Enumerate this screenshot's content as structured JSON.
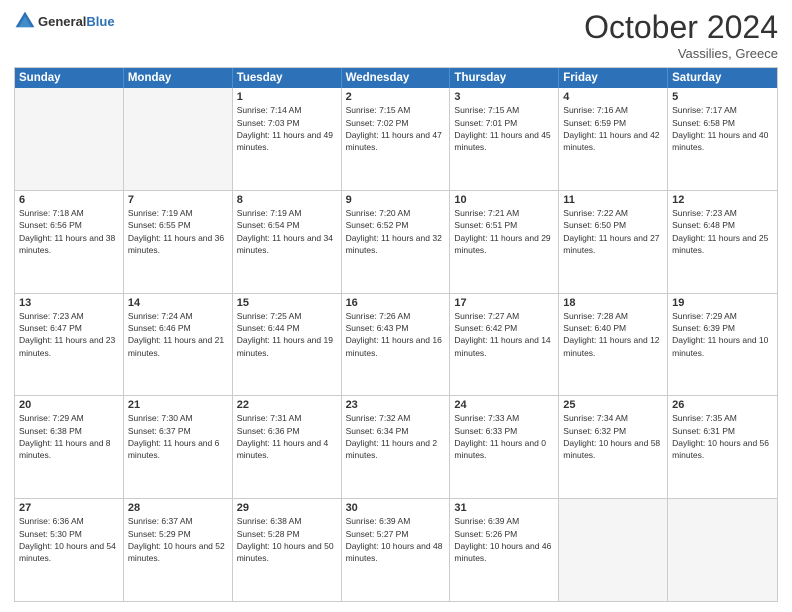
{
  "header": {
    "logo_line1": "General",
    "logo_line2": "Blue",
    "month": "October 2024",
    "location": "Vassilies, Greece"
  },
  "days_of_week": [
    "Sunday",
    "Monday",
    "Tuesday",
    "Wednesday",
    "Thursday",
    "Friday",
    "Saturday"
  ],
  "weeks": [
    [
      {
        "day": "",
        "sunrise": "",
        "sunset": "",
        "daylight": "",
        "empty": true
      },
      {
        "day": "",
        "sunrise": "",
        "sunset": "",
        "daylight": "",
        "empty": true
      },
      {
        "day": "1",
        "sunrise": "Sunrise: 7:14 AM",
        "sunset": "Sunset: 7:03 PM",
        "daylight": "Daylight: 11 hours and 49 minutes."
      },
      {
        "day": "2",
        "sunrise": "Sunrise: 7:15 AM",
        "sunset": "Sunset: 7:02 PM",
        "daylight": "Daylight: 11 hours and 47 minutes."
      },
      {
        "day": "3",
        "sunrise": "Sunrise: 7:15 AM",
        "sunset": "Sunset: 7:01 PM",
        "daylight": "Daylight: 11 hours and 45 minutes."
      },
      {
        "day": "4",
        "sunrise": "Sunrise: 7:16 AM",
        "sunset": "Sunset: 6:59 PM",
        "daylight": "Daylight: 11 hours and 42 minutes."
      },
      {
        "day": "5",
        "sunrise": "Sunrise: 7:17 AM",
        "sunset": "Sunset: 6:58 PM",
        "daylight": "Daylight: 11 hours and 40 minutes."
      }
    ],
    [
      {
        "day": "6",
        "sunrise": "Sunrise: 7:18 AM",
        "sunset": "Sunset: 6:56 PM",
        "daylight": "Daylight: 11 hours and 38 minutes."
      },
      {
        "day": "7",
        "sunrise": "Sunrise: 7:19 AM",
        "sunset": "Sunset: 6:55 PM",
        "daylight": "Daylight: 11 hours and 36 minutes."
      },
      {
        "day": "8",
        "sunrise": "Sunrise: 7:19 AM",
        "sunset": "Sunset: 6:54 PM",
        "daylight": "Daylight: 11 hours and 34 minutes."
      },
      {
        "day": "9",
        "sunrise": "Sunrise: 7:20 AM",
        "sunset": "Sunset: 6:52 PM",
        "daylight": "Daylight: 11 hours and 32 minutes."
      },
      {
        "day": "10",
        "sunrise": "Sunrise: 7:21 AM",
        "sunset": "Sunset: 6:51 PM",
        "daylight": "Daylight: 11 hours and 29 minutes."
      },
      {
        "day": "11",
        "sunrise": "Sunrise: 7:22 AM",
        "sunset": "Sunset: 6:50 PM",
        "daylight": "Daylight: 11 hours and 27 minutes."
      },
      {
        "day": "12",
        "sunrise": "Sunrise: 7:23 AM",
        "sunset": "Sunset: 6:48 PM",
        "daylight": "Daylight: 11 hours and 25 minutes."
      }
    ],
    [
      {
        "day": "13",
        "sunrise": "Sunrise: 7:23 AM",
        "sunset": "Sunset: 6:47 PM",
        "daylight": "Daylight: 11 hours and 23 minutes."
      },
      {
        "day": "14",
        "sunrise": "Sunrise: 7:24 AM",
        "sunset": "Sunset: 6:46 PM",
        "daylight": "Daylight: 11 hours and 21 minutes."
      },
      {
        "day": "15",
        "sunrise": "Sunrise: 7:25 AM",
        "sunset": "Sunset: 6:44 PM",
        "daylight": "Daylight: 11 hours and 19 minutes."
      },
      {
        "day": "16",
        "sunrise": "Sunrise: 7:26 AM",
        "sunset": "Sunset: 6:43 PM",
        "daylight": "Daylight: 11 hours and 16 minutes."
      },
      {
        "day": "17",
        "sunrise": "Sunrise: 7:27 AM",
        "sunset": "Sunset: 6:42 PM",
        "daylight": "Daylight: 11 hours and 14 minutes."
      },
      {
        "day": "18",
        "sunrise": "Sunrise: 7:28 AM",
        "sunset": "Sunset: 6:40 PM",
        "daylight": "Daylight: 11 hours and 12 minutes."
      },
      {
        "day": "19",
        "sunrise": "Sunrise: 7:29 AM",
        "sunset": "Sunset: 6:39 PM",
        "daylight": "Daylight: 11 hours and 10 minutes."
      }
    ],
    [
      {
        "day": "20",
        "sunrise": "Sunrise: 7:29 AM",
        "sunset": "Sunset: 6:38 PM",
        "daylight": "Daylight: 11 hours and 8 minutes."
      },
      {
        "day": "21",
        "sunrise": "Sunrise: 7:30 AM",
        "sunset": "Sunset: 6:37 PM",
        "daylight": "Daylight: 11 hours and 6 minutes."
      },
      {
        "day": "22",
        "sunrise": "Sunrise: 7:31 AM",
        "sunset": "Sunset: 6:36 PM",
        "daylight": "Daylight: 11 hours and 4 minutes."
      },
      {
        "day": "23",
        "sunrise": "Sunrise: 7:32 AM",
        "sunset": "Sunset: 6:34 PM",
        "daylight": "Daylight: 11 hours and 2 minutes."
      },
      {
        "day": "24",
        "sunrise": "Sunrise: 7:33 AM",
        "sunset": "Sunset: 6:33 PM",
        "daylight": "Daylight: 11 hours and 0 minutes."
      },
      {
        "day": "25",
        "sunrise": "Sunrise: 7:34 AM",
        "sunset": "Sunset: 6:32 PM",
        "daylight": "Daylight: 10 hours and 58 minutes."
      },
      {
        "day": "26",
        "sunrise": "Sunrise: 7:35 AM",
        "sunset": "Sunset: 6:31 PM",
        "daylight": "Daylight: 10 hours and 56 minutes."
      }
    ],
    [
      {
        "day": "27",
        "sunrise": "Sunrise: 6:36 AM",
        "sunset": "Sunset: 5:30 PM",
        "daylight": "Daylight: 10 hours and 54 minutes."
      },
      {
        "day": "28",
        "sunrise": "Sunrise: 6:37 AM",
        "sunset": "Sunset: 5:29 PM",
        "daylight": "Daylight: 10 hours and 52 minutes."
      },
      {
        "day": "29",
        "sunrise": "Sunrise: 6:38 AM",
        "sunset": "Sunset: 5:28 PM",
        "daylight": "Daylight: 10 hours and 50 minutes."
      },
      {
        "day": "30",
        "sunrise": "Sunrise: 6:39 AM",
        "sunset": "Sunset: 5:27 PM",
        "daylight": "Daylight: 10 hours and 48 minutes."
      },
      {
        "day": "31",
        "sunrise": "Sunrise: 6:39 AM",
        "sunset": "Sunset: 5:26 PM",
        "daylight": "Daylight: 10 hours and 46 minutes."
      },
      {
        "day": "",
        "sunrise": "",
        "sunset": "",
        "daylight": "",
        "empty": true
      },
      {
        "day": "",
        "sunrise": "",
        "sunset": "",
        "daylight": "",
        "empty": true
      }
    ]
  ]
}
